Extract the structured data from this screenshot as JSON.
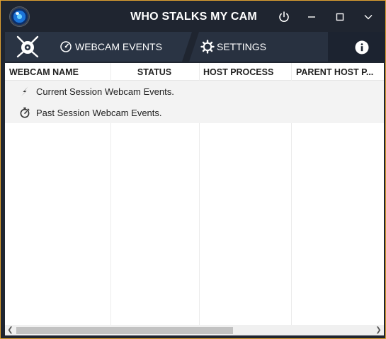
{
  "window": {
    "title": "WHO STALKS MY CAM"
  },
  "tabs": {
    "webcam_events": "WEBCAM EVENTS",
    "settings": "SETTINGS"
  },
  "table": {
    "columns": [
      "WEBCAM NAME",
      "STATUS",
      "HOST PROCESS",
      "PARENT HOST P..."
    ],
    "groups": [
      {
        "label": "Current Session Webcam Events.",
        "icon": "lightning-icon"
      },
      {
        "label": "Past Session Webcam Events.",
        "icon": "stopwatch-icon"
      }
    ]
  },
  "colors": {
    "accent_border": "#e0a030",
    "titlebar": "#1f2530",
    "tab": "#2a3444"
  }
}
